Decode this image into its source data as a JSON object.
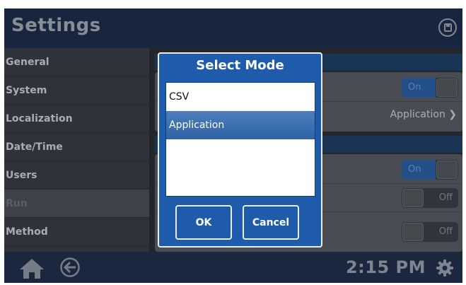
{
  "header": {
    "title": "Settings",
    "save_icon": "save-icon"
  },
  "sidebar": {
    "items": [
      {
        "label": "General"
      },
      {
        "label": "System"
      },
      {
        "label": "Localization"
      },
      {
        "label": "Date/Time"
      },
      {
        "label": "Users"
      },
      {
        "label": "Run",
        "active": true
      },
      {
        "label": "Method"
      }
    ]
  },
  "content": {
    "toggles": {
      "row1": {
        "on_label": "On"
      },
      "row3": {
        "on_label": "On"
      },
      "row4": {
        "off_label": "Off"
      },
      "row5": {
        "off_label": "Off"
      }
    },
    "mode_value": "Application ❯"
  },
  "dialog": {
    "title": "Select Mode",
    "options": [
      "CSV",
      "Application"
    ],
    "selected": "Application",
    "ok_label": "OK",
    "cancel_label": "Cancel"
  },
  "footer": {
    "time": "2:15 PM"
  },
  "colors": {
    "accent": "#1f5bab",
    "toggle_on": "#2b62a6",
    "header_bg": "#1d2f4c"
  }
}
